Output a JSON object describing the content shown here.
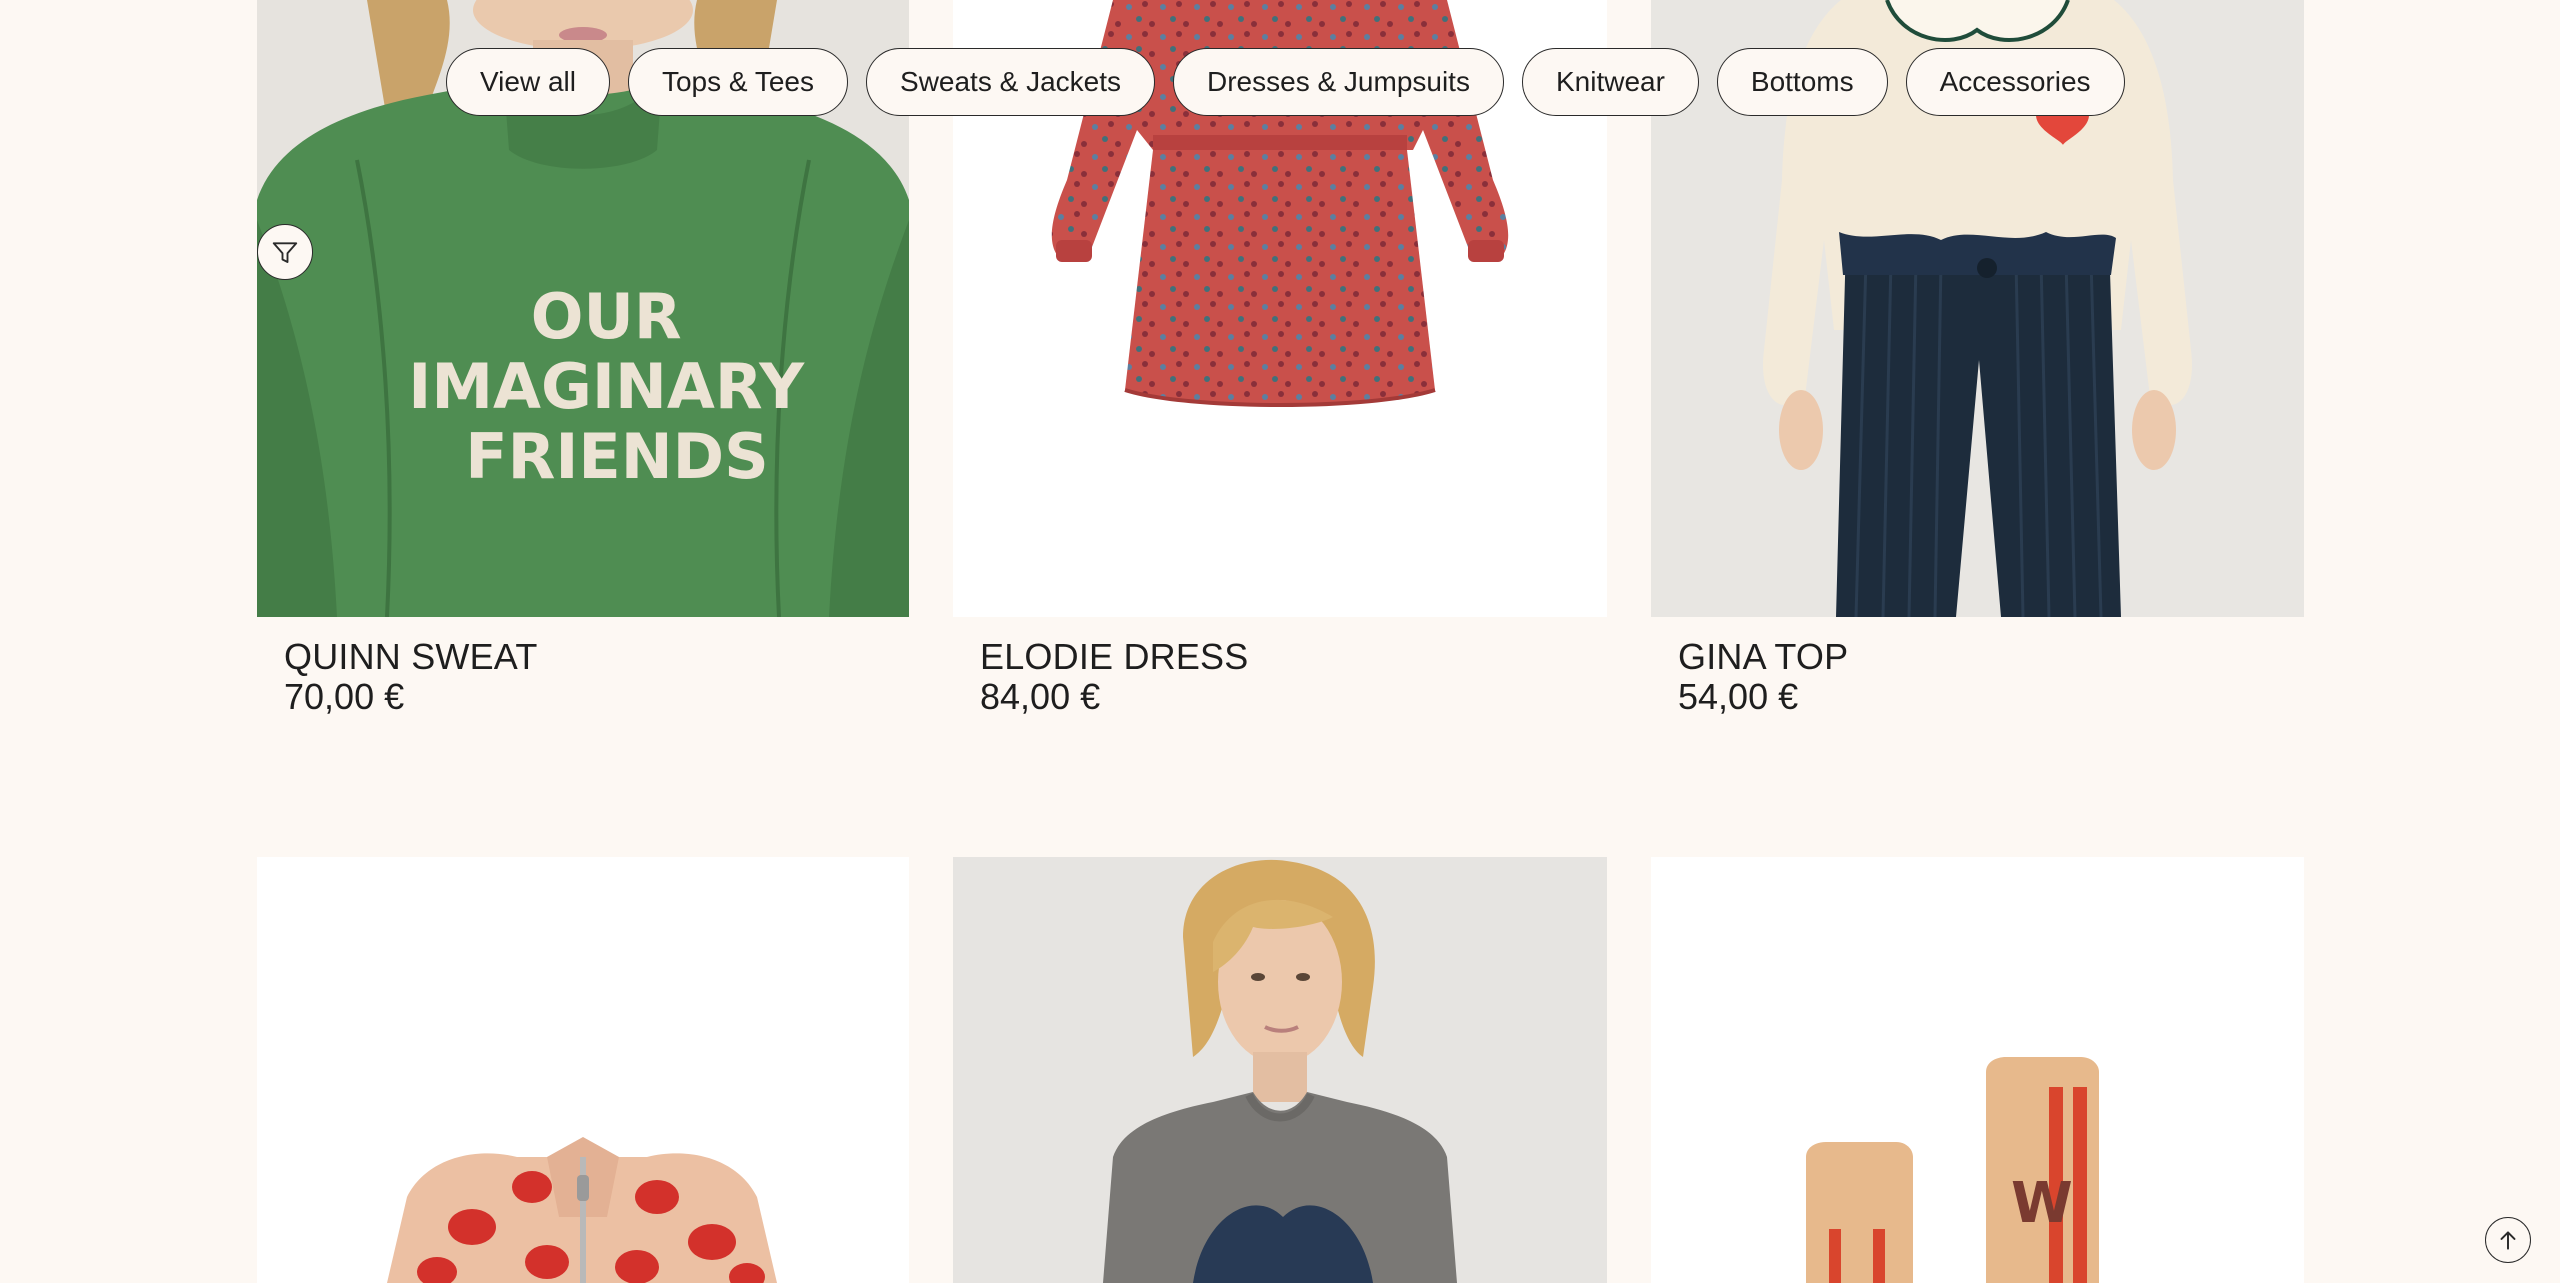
{
  "filters": {
    "categories": [
      {
        "label": "View all"
      },
      {
        "label": "Tops & Tees"
      },
      {
        "label": "Sweats & Jackets"
      },
      {
        "label": "Dresses & Jumpsuits"
      },
      {
        "label": "Knitwear"
      },
      {
        "label": "Bottoms"
      },
      {
        "label": "Accessories"
      }
    ]
  },
  "products": [
    {
      "name": "QUINN SWEAT",
      "price": "70,00 €",
      "image_text": "OUR IMAGINARY FRIENDS"
    },
    {
      "name": "ELODIE DRESS",
      "price": "84,00 €"
    },
    {
      "name": "GINA TOP",
      "price": "54,00 €"
    },
    {
      "name": "",
      "price": ""
    },
    {
      "name": "",
      "price": ""
    },
    {
      "name": "",
      "price": "",
      "image_text": "W"
    }
  ],
  "colors": {
    "background": "#fdf8f3",
    "text": "#1e1e1e",
    "sweat_green": "#4a8a4f",
    "dress_red": "#c9504b",
    "corduroy_navy": "#1d2c3c",
    "sock_tan": "#e7b98c",
    "sock_stripe": "#d9452d"
  },
  "icons": {
    "filter_button": "filter-funnel-icon",
    "back_to_top": "arrow-up-circle-icon"
  }
}
